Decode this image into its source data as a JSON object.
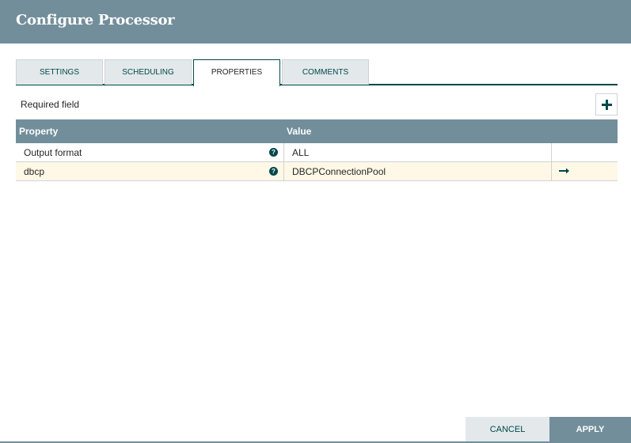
{
  "dialog": {
    "title": "Configure Processor"
  },
  "tabs": [
    {
      "label": "SETTINGS",
      "active": false
    },
    {
      "label": "SCHEDULING",
      "active": false
    },
    {
      "label": "PROPERTIES",
      "active": true
    },
    {
      "label": "COMMENTS",
      "active": false
    }
  ],
  "properties": {
    "required_label": "Required field",
    "add_icon": "plus-icon",
    "columns": {
      "property": "Property",
      "value": "Value"
    },
    "rows": [
      {
        "name": "Output format",
        "value": "ALL",
        "help_icon": "question-circle-icon",
        "action_icon": ""
      },
      {
        "name": "dbcp",
        "value": "DBCPConnectionPool",
        "help_icon": "question-circle-icon",
        "action_icon": "arrow-right-icon"
      }
    ]
  },
  "footer": {
    "cancel_label": "CANCEL",
    "apply_label": "APPLY"
  },
  "colors": {
    "header_bg": "#728e9b",
    "accent": "#004849",
    "tab_bg": "#e3e8eb",
    "highlight_row": "#fff8e6"
  }
}
